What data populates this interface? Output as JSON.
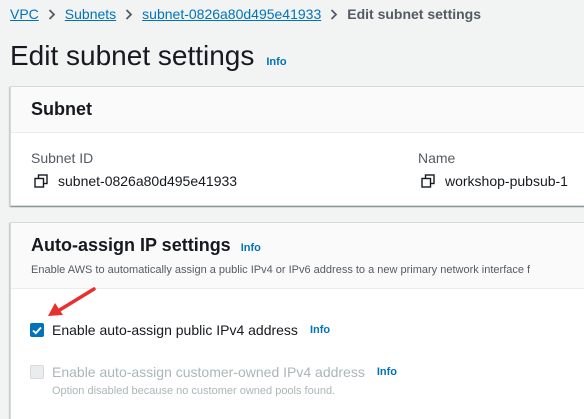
{
  "breadcrumb": {
    "items": [
      "VPC",
      "Subnets",
      "subnet-0826a80d495e41933"
    ],
    "current": "Edit subnet settings"
  },
  "page": {
    "title": "Edit subnet settings",
    "info": "Info"
  },
  "subnet_panel": {
    "title": "Subnet",
    "subnet_id_label": "Subnet ID",
    "subnet_id_value": "subnet-0826a80d495e41933",
    "name_label": "Name",
    "name_value": "workshop-pubsub-1"
  },
  "ip_panel": {
    "title": "Auto-assign IP settings",
    "info": "Info",
    "description": "Enable AWS to automatically assign a public IPv4 or IPv6 address to a new primary network interface f",
    "option_public": {
      "label": "Enable auto-assign public IPv4 address",
      "info": "Info",
      "checked": true,
      "disabled": false
    },
    "option_customer": {
      "label": "Enable auto-assign customer-owned IPv4 address",
      "info": "Info",
      "checked": false,
      "disabled": true,
      "hint": "Option disabled because no customer owned pools found."
    }
  },
  "colors": {
    "link": "#0073bb",
    "annotation_arrow": "#e8302f"
  }
}
